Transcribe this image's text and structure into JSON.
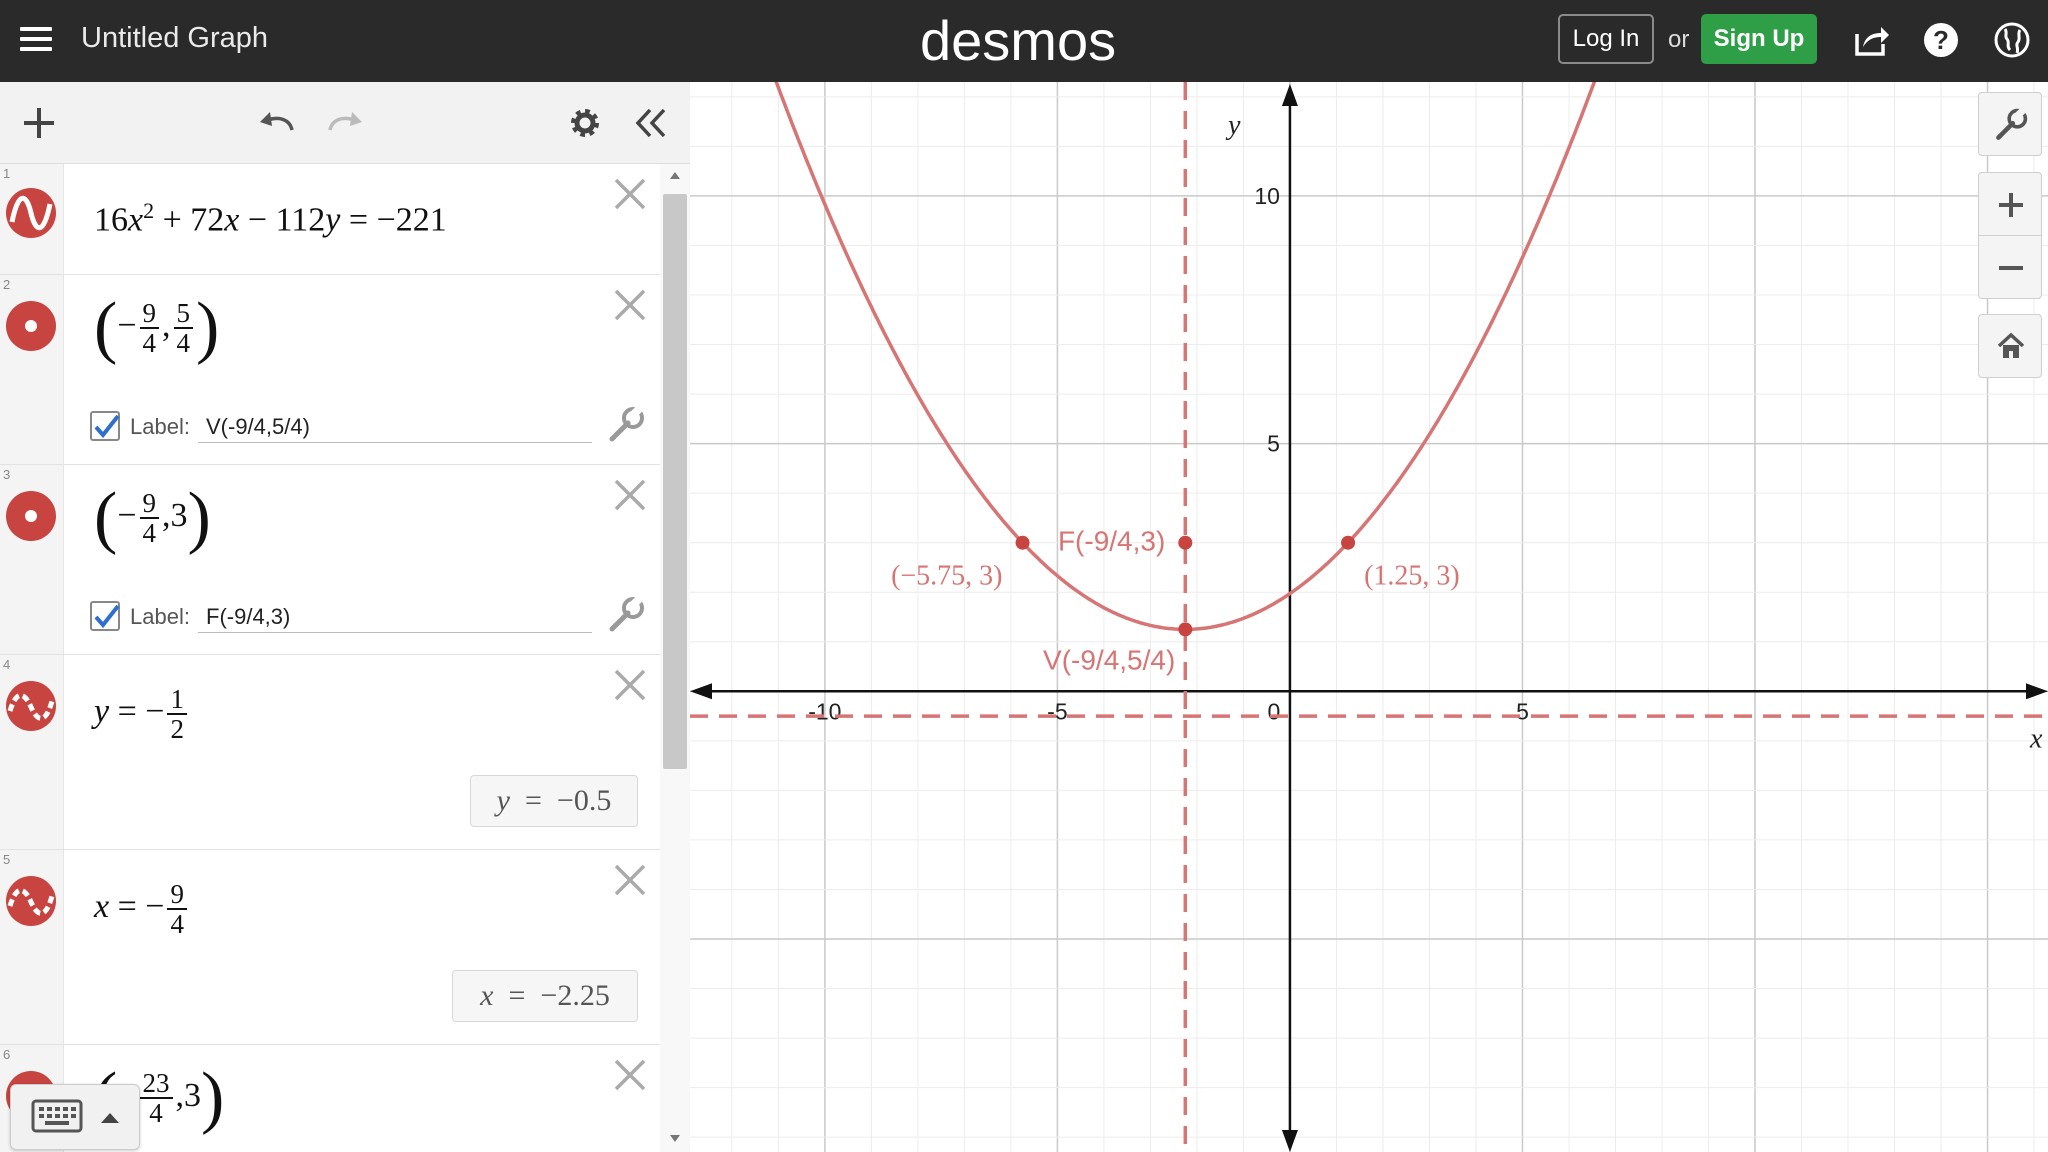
{
  "header": {
    "title": "Untitled Graph",
    "brand": "desmos",
    "login_label": "Log In",
    "or_label": "or",
    "signup_label": "Sign Up",
    "signup_color": "#2f9f47"
  },
  "expressions": [
    {
      "index": "1",
      "latex_text": "16x² + 72x − 112y = −221",
      "color": "#c74440"
    },
    {
      "index": "2",
      "point": {
        "x_num": "9",
        "x_den": "4",
        "y_num": "5",
        "y_den": "4"
      },
      "label_word": "Label:",
      "label_value": "V(-9/4,5/4)",
      "label_checked": true,
      "color": "#c74440"
    },
    {
      "index": "3",
      "point": {
        "x_num": "9",
        "x_den": "4",
        "y_val": "3"
      },
      "label_word": "Label:",
      "label_value": "F(-9/4,3)",
      "label_checked": true,
      "color": "#c74440"
    },
    {
      "index": "4",
      "lhs": "y",
      "num": "1",
      "den": "2",
      "evaluation": {
        "var": "y",
        "value": "−0.5"
      },
      "color": "#c74440"
    },
    {
      "index": "5",
      "lhs": "x",
      "num": "9",
      "den": "4",
      "evaluation": {
        "var": "x",
        "value": "−2.25"
      },
      "color": "#c74440"
    },
    {
      "index": "6",
      "point": {
        "x_num": "23",
        "x_den": "4",
        "y_val": "3"
      },
      "color": "#c74440"
    }
  ],
  "graph": {
    "curve_color": "#d77474",
    "axis_labels": {
      "x": "x",
      "y": "y"
    },
    "x_ticks": [
      "-10",
      "-5",
      "0",
      "5"
    ],
    "y_ticks": [
      "5",
      "10"
    ],
    "point_labels": {
      "vertex": "V(-9/4,5/4)",
      "focus": "F(-9/4,3)",
      "left": "(−5.75, 3)",
      "right": "(1.25, 3)"
    }
  },
  "chart_data": {
    "type": "line",
    "title": "",
    "xlabel": "x",
    "ylabel": "y",
    "xlim": [
      -12.9,
      16.3
    ],
    "ylim": [
      -9.3,
      12.3
    ],
    "grid": true,
    "series": [
      {
        "kind": "parabola",
        "equation": "16x^2 + 72x - 112y = -221",
        "a": 0.142857,
        "b": 0.642857,
        "c": 1.973214
      },
      {
        "kind": "horizontal-line",
        "y": -0.5,
        "style": "dashed"
      },
      {
        "kind": "vertical-line",
        "x": -2.25,
        "style": "dashed"
      }
    ],
    "points": [
      {
        "x": -2.25,
        "y": 1.25,
        "label": "V(-9/4,5/4)"
      },
      {
        "x": -2.25,
        "y": 3,
        "label": "F(-9/4,3)"
      },
      {
        "x": -5.75,
        "y": 3,
        "label": "(−5.75, 3)"
      },
      {
        "x": 1.25,
        "y": 3,
        "label": "(1.25, 3)"
      }
    ]
  }
}
